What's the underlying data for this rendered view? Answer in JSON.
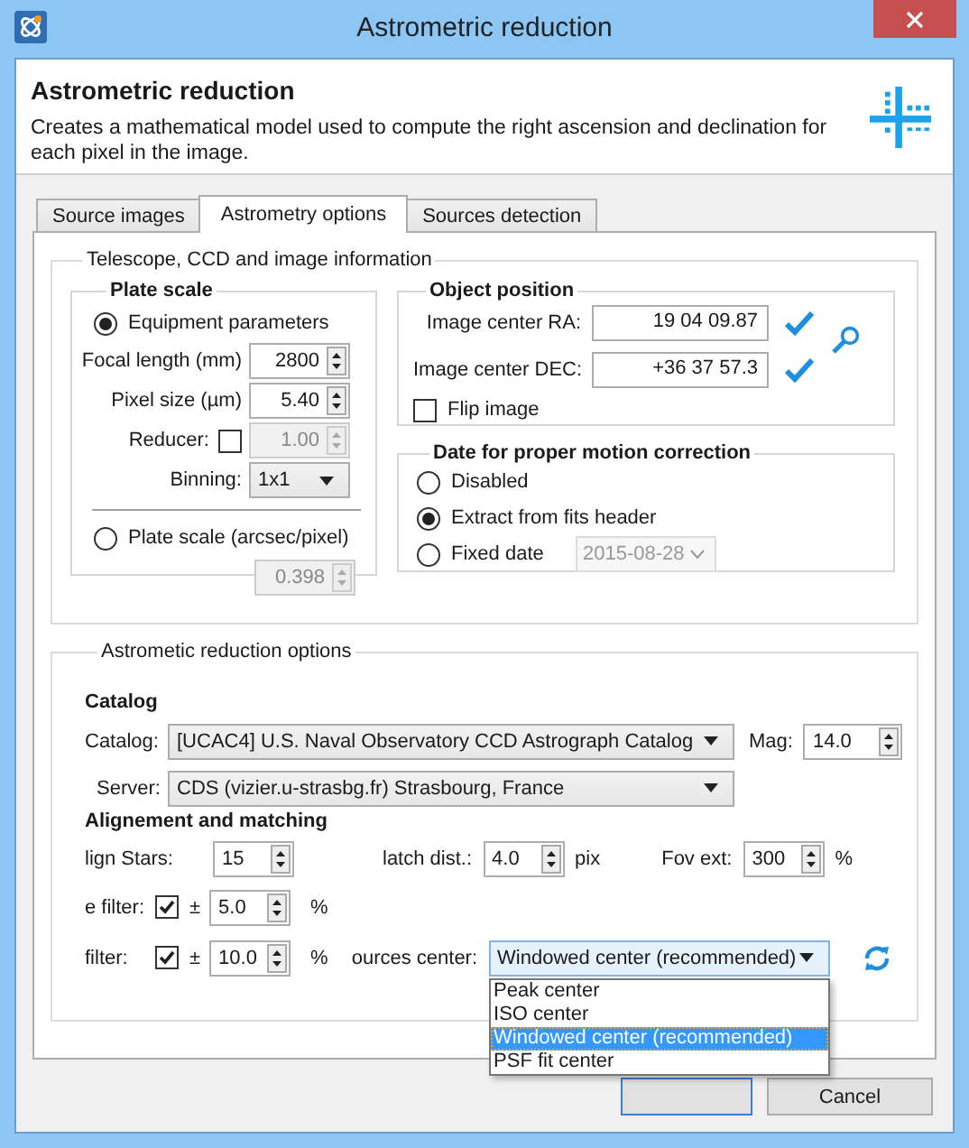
{
  "window": {
    "title": "Astrometric reduction"
  },
  "header": {
    "title": "Astrometric reduction",
    "description": "Creates a mathematical model used to compute the right ascension and declination for each pixel in the image."
  },
  "tabs": [
    {
      "label": "Source images",
      "selected": false
    },
    {
      "label": "Astrometry options",
      "selected": true
    },
    {
      "label": "Sources detection",
      "selected": false
    }
  ],
  "telescope_group": {
    "title": "Telescope, CCD and image information",
    "plate_scale": {
      "title": "Plate scale",
      "modes": [
        {
          "label": "Equipment parameters",
          "selected": true
        },
        {
          "label": "Plate scale (arcsec/pixel)",
          "selected": false
        }
      ],
      "focal_length": {
        "label": "Focal length (mm)",
        "value": "2800",
        "disabled": false
      },
      "pixel_size": {
        "label": "Pixel size (µm)",
        "value": "5.40",
        "disabled": false
      },
      "reducer": {
        "label": "Reducer:",
        "checked": false,
        "value": "1.00",
        "disabled": true
      },
      "binning": {
        "label": "Binning:",
        "value": "1x1"
      },
      "scale_value": {
        "value": "0.398",
        "disabled": true
      }
    },
    "object_position": {
      "title": "Object position",
      "fields": [
        {
          "label": "Image center RA:",
          "value": "19 04 09.87",
          "valid": true
        },
        {
          "label": "Image center DEC:",
          "value": "+36 37 57.3",
          "valid": true
        }
      ],
      "flip_image": {
        "label": "Flip image",
        "checked": false
      }
    },
    "date_correction": {
      "title": "Date for proper motion correction",
      "options": [
        {
          "label": "Disabled",
          "selected": false
        },
        {
          "label": "Extract from fits header",
          "selected": true
        },
        {
          "label": "Fixed date",
          "selected": false
        }
      ],
      "fixed_date": {
        "value": "2015-08-28",
        "disabled": true
      }
    }
  },
  "reduction_group": {
    "title": "Astrometic reduction options",
    "catalog_title": "Catalog",
    "catalog": {
      "label": "Catalog:",
      "value": "[UCAC4] U.S. Naval Observatory CCD Astrograph Catalog"
    },
    "mag": {
      "label": "Mag:",
      "value": "14.0"
    },
    "server": {
      "label": "Server:",
      "value": "CDS (vizier.u-strasbg.fr) Strasbourg, France"
    },
    "alignment_title": "Alignement and matching",
    "align_stars": {
      "label": "lign Stars:",
      "value": "15"
    },
    "match_dist": {
      "label": "latch dist.:",
      "value": "4.0",
      "unit": "pix"
    },
    "fov_ext": {
      "label": "Fov ext:",
      "value": "300",
      "unit": "%"
    },
    "filters": [
      {
        "label": "e filter:",
        "checked": true,
        "sign": "±",
        "value": "5.0",
        "unit": "%"
      },
      {
        "label": "filter:",
        "checked": true,
        "sign": "±",
        "value": "10.0",
        "unit": "%"
      }
    ],
    "sources_center": {
      "label": "ources center:",
      "value": "Windowed center (recommended)",
      "expanded": true,
      "options": [
        {
          "label": "Peak center",
          "selected": false
        },
        {
          "label": "ISO center",
          "selected": false
        },
        {
          "label": "Windowed center (recommended)",
          "selected": true
        },
        {
          "label": "PSF fit center",
          "selected": false
        }
      ]
    }
  },
  "buttons": [
    {
      "kind": "default"
    },
    {
      "kind": "normal",
      "label": "Cancel"
    }
  ]
}
